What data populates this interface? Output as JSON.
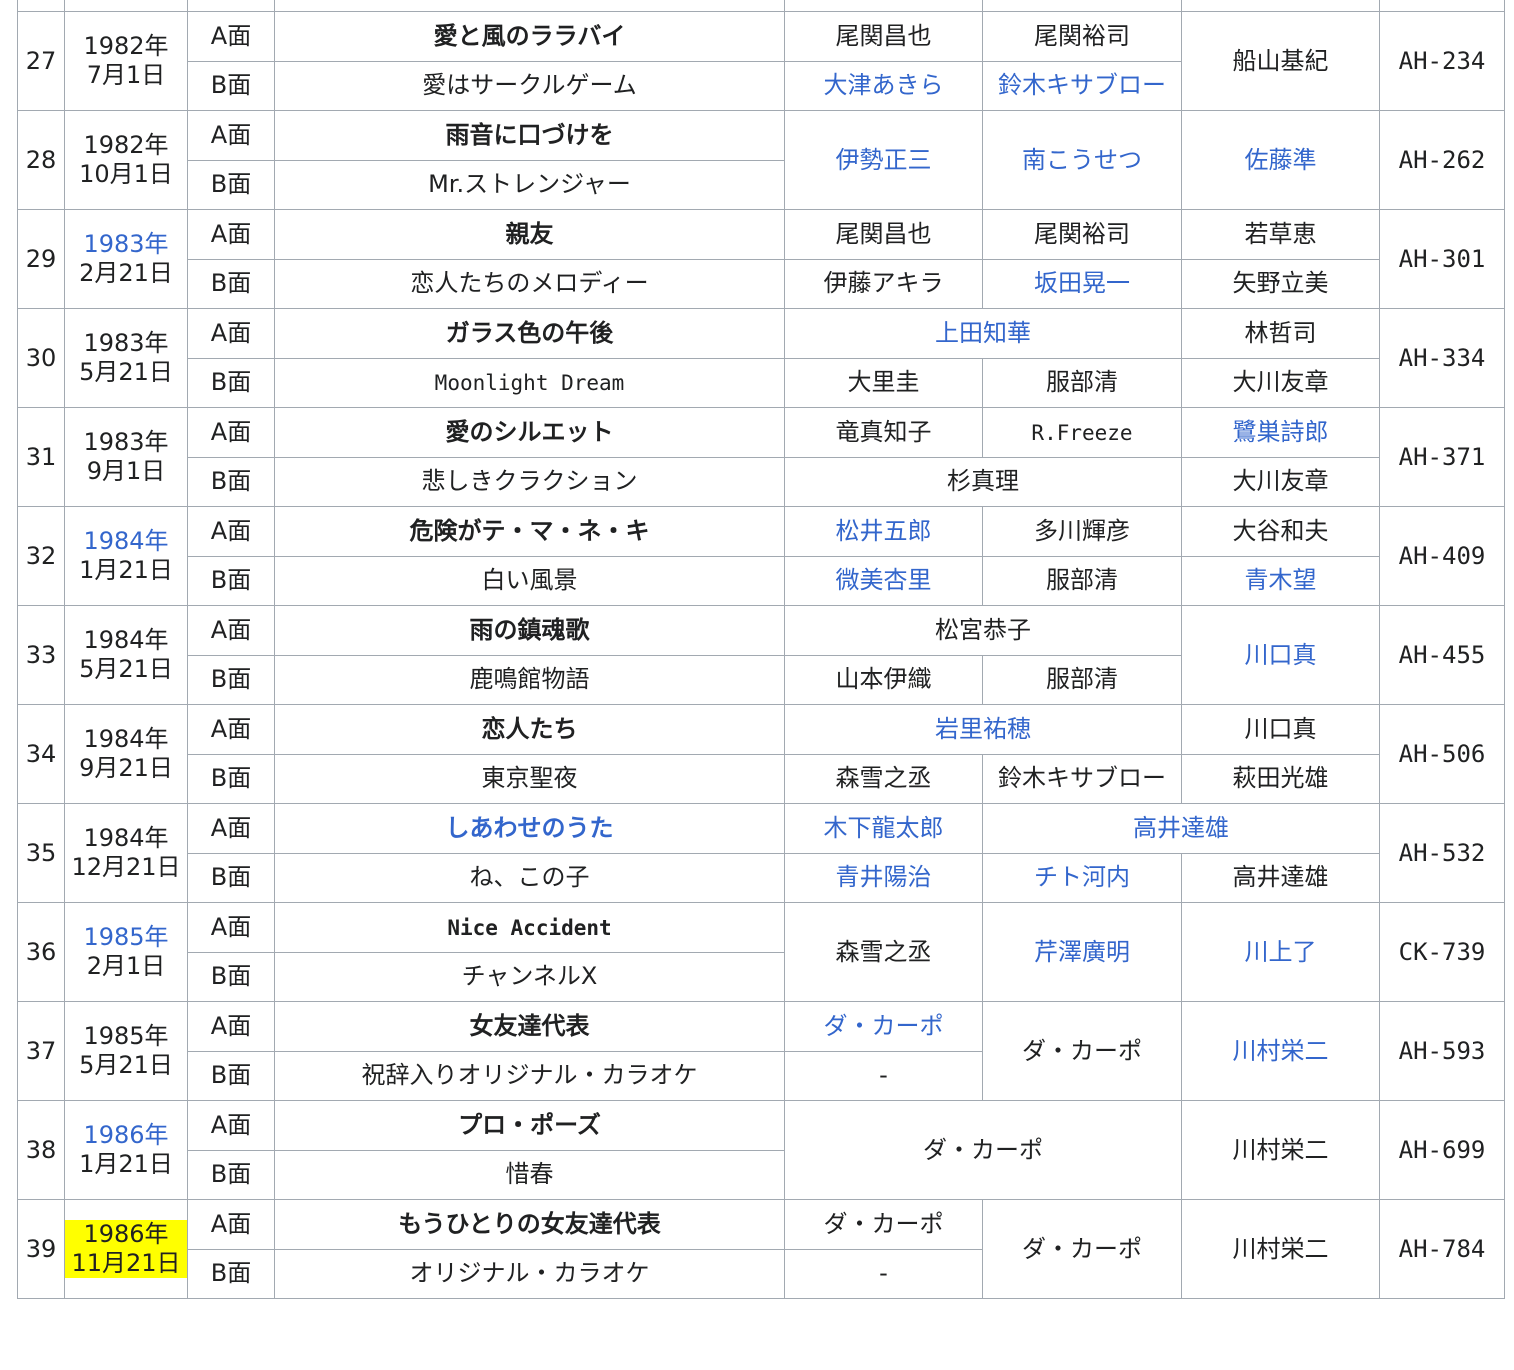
{
  "rows": [
    {
      "no": "27",
      "year": "1982年",
      "year_link": false,
      "day": "7月1日",
      "a_side": "A面",
      "b_side": "B面",
      "a_title": "愛と風のララバイ",
      "a_title_link": false,
      "b_title": "愛はサークルゲーム",
      "b_title_link": false,
      "a_lyric": "尾関昌也",
      "a_lyric_link": false,
      "a_comp": "尾関裕司",
      "a_comp_link": false,
      "b_lyric": "大津あきら",
      "b_lyric_link": true,
      "b_comp": "鈴木キサブロー",
      "b_comp_link": true,
      "arranger": "船山基紀",
      "arranger_link": false,
      "catalog": "AH-234"
    },
    {
      "no": "28",
      "year": "1982年",
      "year_link": false,
      "day": "10月1日",
      "a_side": "A面",
      "b_side": "B面",
      "a_title": "雨音に口づけを",
      "a_title_link": false,
      "b_title": "Mr.ストレンジャー",
      "b_title_link": false,
      "lyric": "伊勢正三",
      "lyric_link": true,
      "comp": "南こうせつ",
      "comp_link": true,
      "arranger": "佐藤準",
      "arranger_link": true,
      "catalog": "AH-262"
    },
    {
      "no": "29",
      "year": "1983年",
      "year_link": true,
      "day": "2月21日",
      "a_side": "A面",
      "b_side": "B面",
      "a_title": "親友",
      "a_title_link": false,
      "b_title": "恋人たちのメロディー",
      "b_title_link": false,
      "a_lyric": "尾関昌也",
      "a_lyric_link": false,
      "a_comp": "尾関裕司",
      "a_comp_link": false,
      "a_arr": "若草恵",
      "a_arr_link": false,
      "b_lyric": "伊藤アキラ",
      "b_lyric_link": false,
      "b_comp": "坂田晃一",
      "b_comp_link": true,
      "b_arr": "矢野立美",
      "b_arr_link": false,
      "catalog": "AH-301"
    },
    {
      "no": "30",
      "year": "1983年",
      "year_link": false,
      "day": "5月21日",
      "a_side": "A面",
      "b_side": "B面",
      "a_title": "ガラス色の午後",
      "a_title_link": false,
      "b_title": "Moonlight Dream",
      "b_title_link": false,
      "a_writer": "上田知華",
      "a_writer_link": true,
      "a_arr": "林哲司",
      "a_arr_link": false,
      "b_lyric": "大里圭",
      "b_lyric_link": false,
      "b_comp": "服部清",
      "b_comp_link": false,
      "b_arr": "大川友章",
      "b_arr_link": false,
      "catalog": "AH-334"
    },
    {
      "no": "31",
      "year": "1983年",
      "year_link": false,
      "day": "9月1日",
      "a_side": "A面",
      "b_side": "B面",
      "a_title": "愛のシルエット",
      "a_title_link": false,
      "b_title": "悲しきクラクション",
      "b_title_link": false,
      "a_lyric": "竜真知子",
      "a_lyric_link": false,
      "a_comp": "R.Freeze",
      "a_comp_link": false,
      "a_arr": "鷺巣詩郎",
      "a_arr_link": true,
      "b_writer": "杉真理",
      "b_writer_link": false,
      "b_arr": "大川友章",
      "b_arr_link": false,
      "catalog": "AH-371"
    },
    {
      "no": "32",
      "year": "1984年",
      "year_link": true,
      "day": "1月21日",
      "a_side": "A面",
      "b_side": "B面",
      "a_title": "危険がテ・マ・ネ・キ",
      "a_title_link": false,
      "b_title": "白い風景",
      "b_title_link": false,
      "a_lyric": "松井五郎",
      "a_lyric_link": true,
      "a_comp": "多川輝彦",
      "a_comp_link": false,
      "a_arr": "大谷和夫",
      "a_arr_link": false,
      "b_lyric": "微美杏里",
      "b_lyric_link": true,
      "b_comp": "服部清",
      "b_comp_link": false,
      "b_arr": "青木望",
      "b_arr_link": true,
      "catalog": "AH-409"
    },
    {
      "no": "33",
      "year": "1984年",
      "year_link": false,
      "day": "5月21日",
      "a_side": "A面",
      "b_side": "B面",
      "a_title": "雨の鎮魂歌",
      "a_title_link": false,
      "b_title": "鹿鳴館物語",
      "b_title_link": false,
      "a_writer": "松宮恭子",
      "a_writer_link": false,
      "b_lyric": "山本伊織",
      "b_lyric_link": false,
      "b_comp": "服部清",
      "b_comp_link": false,
      "arranger": "川口真",
      "arranger_link": true,
      "catalog": "AH-455"
    },
    {
      "no": "34",
      "year": "1984年",
      "year_link": false,
      "day": "9月21日",
      "a_side": "A面",
      "b_side": "B面",
      "a_title": "恋人たち",
      "a_title_link": false,
      "b_title": "東京聖夜",
      "b_title_link": false,
      "a_writer": "岩里祐穂",
      "a_writer_link": true,
      "a_arr": "川口真",
      "a_arr_link": false,
      "b_lyric": "森雪之丞",
      "b_lyric_link": false,
      "b_comp": "鈴木キサブロー",
      "b_comp_link": false,
      "b_arr": "萩田光雄",
      "b_arr_link": false,
      "catalog": "AH-506"
    },
    {
      "no": "35",
      "year": "1984年",
      "year_link": false,
      "day": "12月21日",
      "a_side": "A面",
      "b_side": "B面",
      "a_title": "しあわせのうた",
      "a_title_link": true,
      "b_title": "ね、この子",
      "b_title_link": false,
      "a_lyric": "木下龍太郎",
      "a_lyric_link": true,
      "a_compArr": "高井達雄",
      "a_compArr_link": true,
      "b_lyric": "青井陽治",
      "b_lyric_link": true,
      "b_comp": "チト河内",
      "b_comp_link": true,
      "b_arr": "高井達雄",
      "b_arr_link": false,
      "catalog": "AH-532"
    },
    {
      "no": "36",
      "year": "1985年",
      "year_link": true,
      "day": "2月1日",
      "a_side": "A面",
      "b_side": "B面",
      "a_title": "Nice Accident",
      "a_title_link": false,
      "b_title": "チャンネルX",
      "b_title_link": false,
      "lyric": "森雪之丞",
      "lyric_link": false,
      "comp": "芹澤廣明",
      "comp_link": true,
      "arranger": "川上了",
      "arranger_link": true,
      "catalog": "CK-739"
    },
    {
      "no": "37",
      "year": "1985年",
      "year_link": false,
      "day": "5月21日",
      "a_side": "A面",
      "b_side": "B面",
      "a_title": "女友達代表",
      "a_title_link": false,
      "b_title": "祝辞入りオリジナル・カラオケ",
      "b_title_link": false,
      "a_lyric": "ダ・カーポ",
      "a_lyric_link": true,
      "b_lyric": "-",
      "b_lyric_link": false,
      "comp": "ダ・カーポ",
      "comp_link": false,
      "arranger": "川村栄二",
      "arranger_link": true,
      "catalog": "AH-593"
    },
    {
      "no": "38",
      "year": "1986年",
      "year_link": true,
      "day": "1月21日",
      "a_side": "A面",
      "b_side": "B面",
      "a_title": "プロ・ポーズ",
      "a_title_link": false,
      "b_title": "惜春",
      "b_title_link": false,
      "writer": "ダ・カーポ",
      "writer_link": false,
      "arranger": "川村栄二",
      "arranger_link": false,
      "catalog": "AH-699"
    },
    {
      "no": "39",
      "year": "1986年",
      "year_link": false,
      "day": "11月21日",
      "a_side": "A面",
      "b_side": "B面",
      "a_title": "もうひとりの女友達代表",
      "a_title_link": false,
      "b_title": "オリジナル・カラオケ",
      "b_title_link": false,
      "a_lyric": "ダ・カーポ",
      "a_lyric_link": false,
      "b_lyric": "-",
      "b_lyric_link": false,
      "comp": "ダ・カーポ",
      "comp_link": false,
      "arranger": "川村栄二",
      "arranger_link": false,
      "catalog": "AH-784"
    }
  ],
  "colors": {
    "link": "#3366cc",
    "border": "#a2a9b1",
    "highlight": "#ffff00",
    "text": "#202122"
  }
}
